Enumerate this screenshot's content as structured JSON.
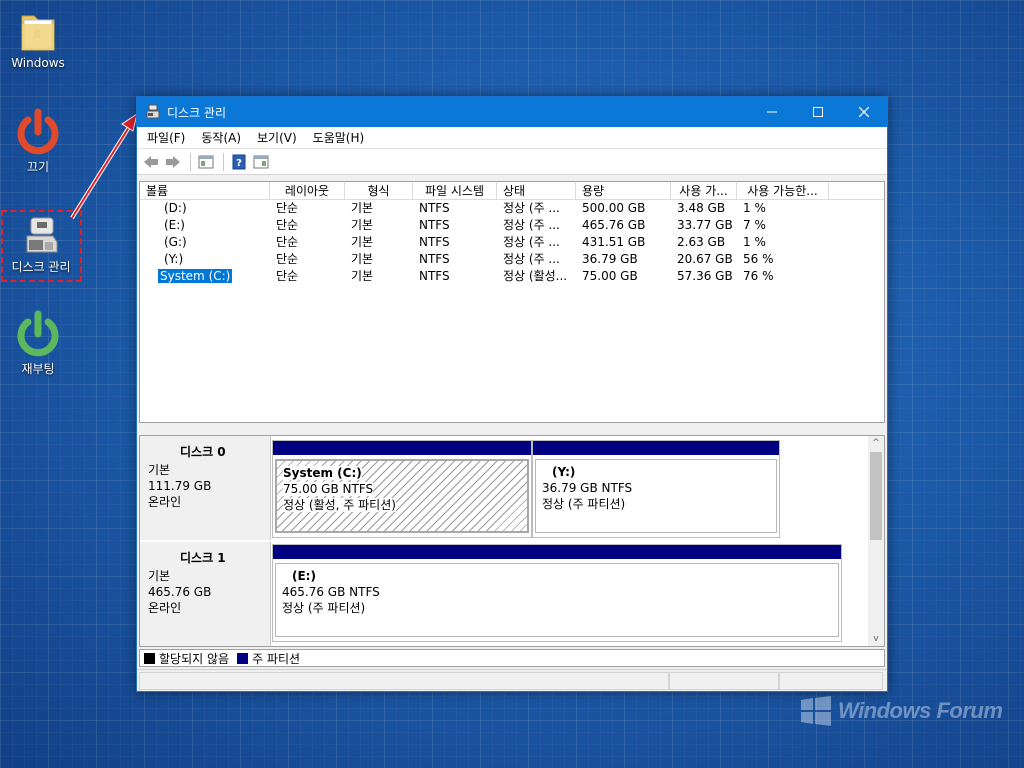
{
  "desktop": {
    "icons": [
      {
        "label": "Windows"
      },
      {
        "label": "끄기"
      },
      {
        "label": "디스크 관리"
      },
      {
        "label": "재부팅"
      }
    ],
    "colors": {
      "shutdown": "#e04a2a",
      "reboot": "#5cb85c",
      "highlight": "#e0202a"
    }
  },
  "window": {
    "title": "디스크 관리",
    "controls": {
      "minimize": "—",
      "maximize": "☐",
      "close": "✕"
    },
    "menu": [
      "파일(F)",
      "동작(A)",
      "보기(V)",
      "도움말(H)"
    ],
    "toolbar": [
      "back-icon",
      "forward-icon",
      "console-tree-icon",
      "help-icon",
      "action-pane-icon"
    ],
    "volumes": {
      "headers": [
        "볼륨",
        "레이아웃",
        "형식",
        "파일 시스템",
        "상태",
        "용량",
        "사용 가...",
        "사용 가능한..."
      ],
      "rows": [
        {
          "volume": "(D:)",
          "layout": "단순",
          "type": "기본",
          "fs": "NTFS",
          "status": "정상 (주 ...",
          "capacity": "500.00 GB",
          "free": "3.48 GB",
          "pct": "1 %"
        },
        {
          "volume": "(E:)",
          "layout": "단순",
          "type": "기본",
          "fs": "NTFS",
          "status": "정상 (주 ...",
          "capacity": "465.76 GB",
          "free": "33.77 GB",
          "pct": "7 %"
        },
        {
          "volume": "(G:)",
          "layout": "단순",
          "type": "기본",
          "fs": "NTFS",
          "status": "정상 (주 ...",
          "capacity": "431.51 GB",
          "free": "2.63 GB",
          "pct": "1 %"
        },
        {
          "volume": "(Y:)",
          "layout": "단순",
          "type": "기본",
          "fs": "NTFS",
          "status": "정상 (주 ...",
          "capacity": "36.79 GB",
          "free": "20.67 GB",
          "pct": "56 %"
        },
        {
          "volume": "System (C:)",
          "layout": "단순",
          "type": "기본",
          "fs": "NTFS",
          "status": "정상 (활성...",
          "capacity": "75.00 GB",
          "free": "57.36 GB",
          "pct": "76 %"
        }
      ]
    },
    "disks": [
      {
        "name": "디스크 0",
        "kind": "기본",
        "size": "111.79 GB",
        "state": "온라인",
        "partitions": [
          {
            "name": "System  (C:)",
            "size": "75.00 GB NTFS",
            "status": "정상 (활성, 주 파티션)"
          },
          {
            "name": "(Y:)",
            "size": "36.79 GB NTFS",
            "status": "정상 (주 파티션)"
          }
        ]
      },
      {
        "name": "디스크 1",
        "kind": "기본",
        "size": "465.76 GB",
        "state": "온라인",
        "partitions": [
          {
            "name": "(E:)",
            "size": "465.76 GB NTFS",
            "status": "정상 (주 파티션)"
          }
        ]
      }
    ],
    "legend": [
      {
        "label": "할당되지 않음",
        "color": "#000000"
      },
      {
        "label": "주 파티션",
        "color": "#000080"
      }
    ],
    "scroll": {
      "up": "^",
      "down": "v"
    }
  },
  "watermark": {
    "text": "Windows Forum"
  }
}
